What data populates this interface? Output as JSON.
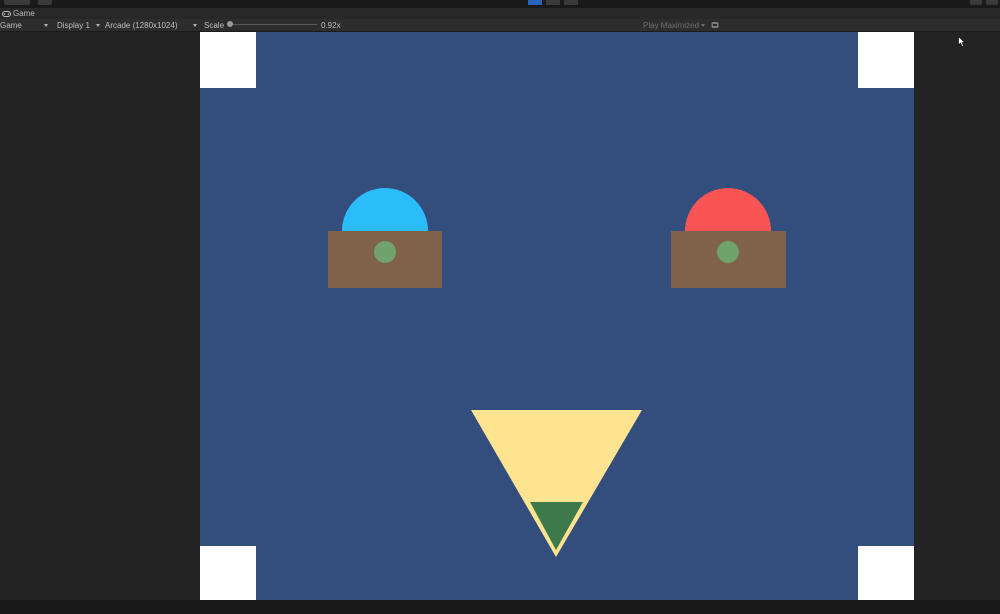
{
  "window": {
    "tab_label": "Game"
  },
  "toolbar": {
    "game_view_label": "Game",
    "display_label": "Display 1",
    "resolution_label": "Arcade (1280x1024)",
    "scale_label": "Scale",
    "scale_value": "0.92x",
    "play_mode_label": "Play Maximized"
  },
  "icons": {
    "tab_icon": "gamepad-icon",
    "play_mode_icon": "play-mode-icon",
    "cursor": "mouse-cursor-icon"
  },
  "colors": {
    "game_background": "#334e7c",
    "corner_marker": "#ffffff",
    "player_left_head": "#2bbdfa",
    "player_right_head": "#f95454",
    "player_body": "#80624b",
    "player_button": "#6fa26d",
    "triangle_outer": "#fee391",
    "triangle_inner": "#3e7a49",
    "play_button_active": "#2863bb"
  }
}
